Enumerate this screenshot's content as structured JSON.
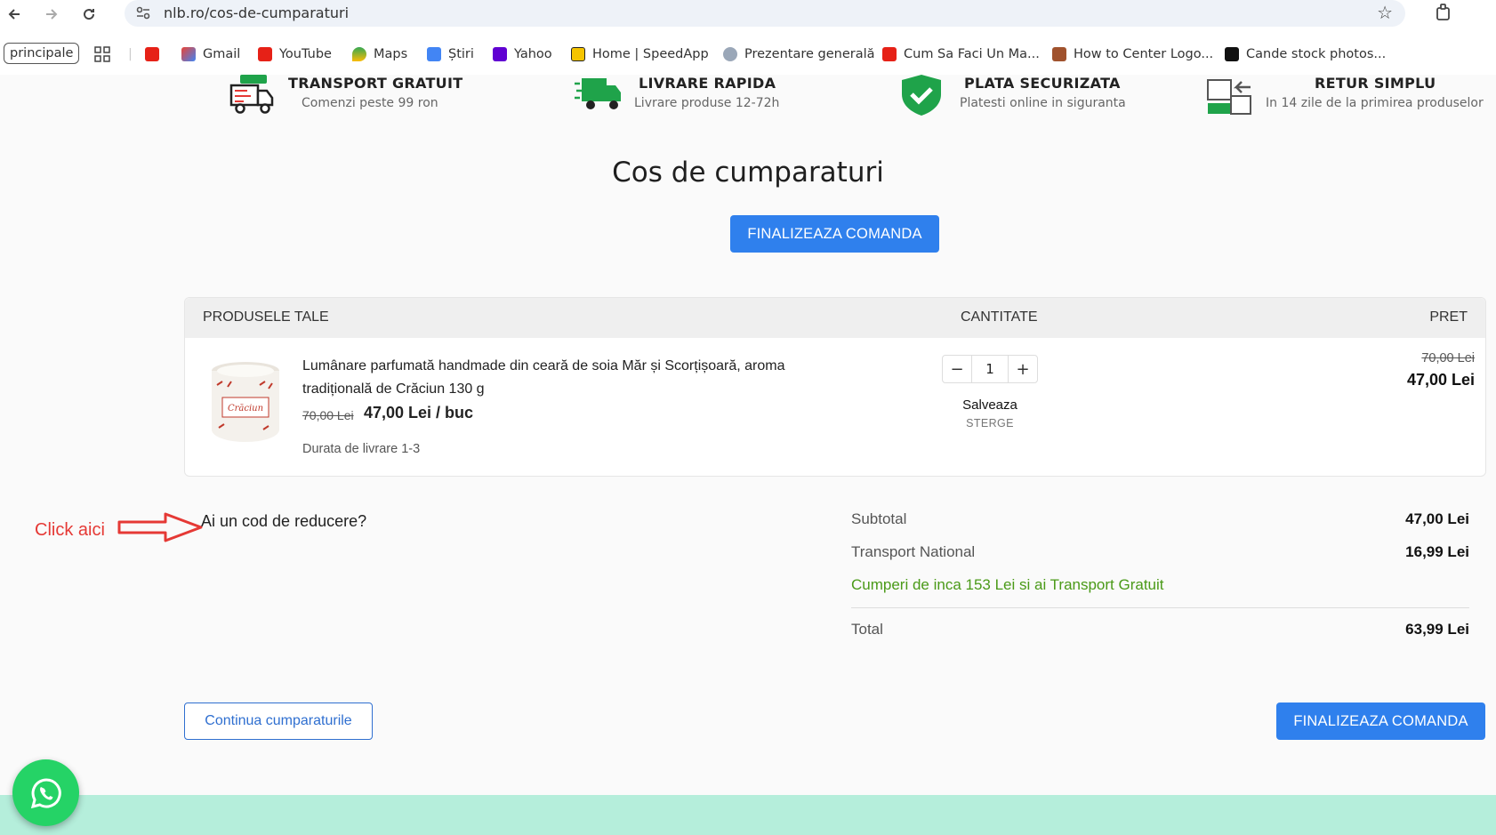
{
  "browser": {
    "url": "nlb.ro/cos-de-cumparaturi",
    "bookmarks": [
      {
        "label": "principale"
      },
      {
        "label": "Gmail"
      },
      {
        "label": "YouTube"
      },
      {
        "label": "Maps"
      },
      {
        "label": "Știri"
      },
      {
        "label": "Yahoo"
      },
      {
        "label": "Home | SpeedApp"
      },
      {
        "label": "Prezentare generală"
      },
      {
        "label": "Cum Sa Faci Un Ma..."
      },
      {
        "label": "How to Center Logo..."
      },
      {
        "label": "Cande stock photos..."
      }
    ]
  },
  "features": [
    {
      "title": "TRANSPORT GRATUIT",
      "subtitle": "Comenzi peste 99 ron",
      "icon": "free-truck-icon"
    },
    {
      "title": "LIVRARE RAPIDA",
      "subtitle": "Livrare produse 12-72h",
      "icon": "fast-truck-icon"
    },
    {
      "title": "PLATA SECURIZATA",
      "subtitle": "Platesti online in siguranta",
      "icon": "shield-check-icon"
    },
    {
      "title": "RETUR SIMPLU",
      "subtitle": "In 14 zile de la primirea produselor",
      "icon": "return-box-icon"
    }
  ],
  "cart": {
    "title": "Cos de cumparaturi",
    "checkout_label": "FINALIZEAZA COMANDA",
    "headers": {
      "products": "PRODUSELE TALE",
      "quantity": "CANTITATE",
      "price": "PRET"
    },
    "item": {
      "name": "Lumânare parfumată handmade din ceară de soia Măr și Scorțișoară, aroma tradițională de Crăciun 130 g",
      "old_price": "70,00 Lei",
      "unit_price": "47,00 Lei / buc",
      "delivery": "Durata de livrare 1-3",
      "quantity": "1",
      "save_label": "Salveaza",
      "delete_label": "STERGE",
      "price_old": "70,00 Lei",
      "price": "47,00 Lei"
    }
  },
  "annotation": {
    "note": "Click aici"
  },
  "discount": {
    "label": "Ai un cod de reducere?"
  },
  "summary": {
    "subtotal_label": "Subtotal",
    "subtotal_value": "47,00 Lei",
    "shipping_label": "Transport National",
    "shipping_value": "16,99 Lei",
    "promo": "Cumperi de inca 153 Lei si ai Transport Gratuit",
    "total_label": "Total",
    "total_value": "63,99 Lei"
  },
  "actions": {
    "continue_label": "Continua cumparaturile",
    "checkout_label": "FINALIZEAZA COMANDA"
  },
  "colors": {
    "primary": "#2f80ed",
    "promo": "#4a9a18",
    "annotation": "#e53935",
    "whatsapp": "#25d366",
    "footer": "#b5eedb"
  }
}
